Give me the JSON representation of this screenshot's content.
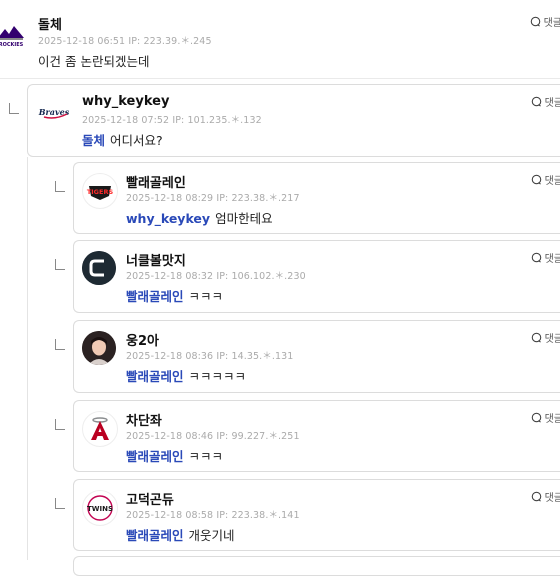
{
  "reply_label": "댓글",
  "comments": [
    {
      "id": "c0",
      "name": "돌체",
      "meta": "2025-12-18 06:51  IP: 223.39.＊.245",
      "text": "이건 좀 논란되겠는데",
      "mention": ""
    },
    {
      "id": "c1",
      "name": "why_keykey",
      "meta": "2025-12-18 07:52  IP: 101.235.＊.132",
      "mention": "돌체",
      "text": "어디서요?"
    },
    {
      "id": "c2",
      "name": "빨래골레인",
      "meta": "2025-12-18 08:29  IP: 223.38.＊.217",
      "mention": "why_keykey",
      "text": "엄마한테요"
    },
    {
      "id": "c3",
      "name": "너클볼맛지",
      "meta": "2025-12-18 08:32  IP: 106.102.＊.230",
      "mention": "빨래골레인",
      "text": "ㅋㅋㅋ"
    },
    {
      "id": "c4",
      "name": "웅2아",
      "meta": "2025-12-18 08:36  IP: 14.35.＊.131",
      "mention": "빨래골레인",
      "text": "ㅋㅋㅋㅋㅋ"
    },
    {
      "id": "c5",
      "name": "차단좌",
      "meta": "2025-12-18 08:46  IP: 99.227.＊.251",
      "mention": "빨래골레인",
      "text": "ㅋㅋㅋ"
    },
    {
      "id": "c6",
      "name": "고덕곤듀",
      "meta": "2025-12-18 08:58  IP: 223.38.＊.141",
      "mention": "빨래골레인",
      "text": "개웃기네"
    }
  ],
  "team_logos": {
    "c0": {
      "icon": "rockies-logo-icon",
      "text": "",
      "color": "#33006f"
    },
    "c1": {
      "icon": "braves-logo-icon",
      "text": "Braves",
      "color": "#13274f"
    },
    "c2": {
      "icon": "tigers-logo-icon",
      "text": "TIGERS",
      "color": "#c8102e"
    },
    "c3": {
      "icon": "c-logo-icon",
      "text": "C",
      "color": "#1e2a33"
    },
    "c5": {
      "icon": "angels-logo-icon",
      "text": "A",
      "color": "#ba0021"
    },
    "c6": {
      "icon": "twins-logo-icon",
      "text": "TWINS",
      "color": "#c30452"
    }
  }
}
